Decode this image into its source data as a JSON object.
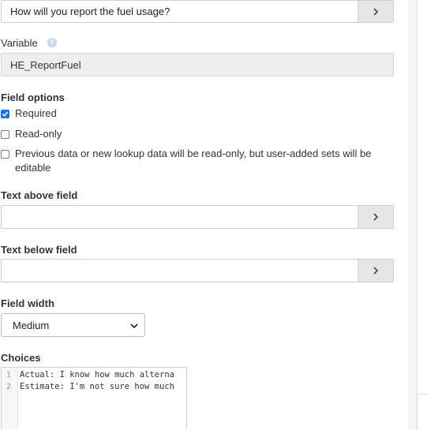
{
  "question_field": {
    "value": "How will you report the fuel usage?",
    "button_icon": "chevron-right-icon"
  },
  "variable": {
    "label": "Variable",
    "help_icon": "question-circle-icon",
    "value": "HE_ReportFuel"
  },
  "field_options": {
    "label": "Field options",
    "required": {
      "label": "Required",
      "checked": true
    },
    "read_only": {
      "label": "Read-only",
      "checked": false
    },
    "previous_data": {
      "label_line1": "Previous data or new lookup data will be read-only, but user-added sets will be",
      "label_line2": "editable",
      "checked": false
    }
  },
  "text_above": {
    "label": "Text above field",
    "value": "",
    "button_icon": "chevron-right-icon"
  },
  "text_below": {
    "label": "Text below field",
    "value": "",
    "button_icon": "chevron-right-icon"
  },
  "field_width": {
    "label": "Field width",
    "selected": "Medium",
    "icon": "chevron-down-icon"
  },
  "choices": {
    "label": "Choices",
    "lines": [
      {
        "num": "1",
        "text": "Actual: I know how much alterna"
      },
      {
        "num": "2",
        "text": "Estimate: I'm not sure how much"
      }
    ]
  },
  "colors": {
    "accent": "#1a73e8",
    "button_bg": "#e6e6e6",
    "readonly_bg": "#eeeeee"
  }
}
